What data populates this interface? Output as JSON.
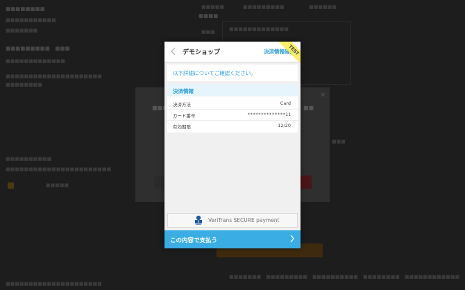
{
  "modal": {
    "shop_name": "デモショップ",
    "step_label": "決済情報確認",
    "test_badge": "TEST",
    "confirm_message": "以下詳細についてご確認ください。",
    "section_title": "決済情報",
    "rows": [
      {
        "label": "決済方法",
        "value": "Card"
      },
      {
        "label": "カード番号",
        "value": "**************11"
      },
      {
        "label": "有効期限",
        "value": "12/20"
      }
    ],
    "secure_text": "VeriTrans SECURE payment",
    "pay_button_label": "この内容で支払う"
  },
  "colors": {
    "accent": "#3aaee4",
    "link": "#2b9fd8",
    "test_ribbon": "#f7ee59",
    "info_header_bg": "#e6f4fb"
  },
  "icons": {
    "back": "chevron-left-icon",
    "pay": "chevron-right-icon",
    "secure": "secure-shield-logo-icon",
    "close": "close-icon"
  }
}
